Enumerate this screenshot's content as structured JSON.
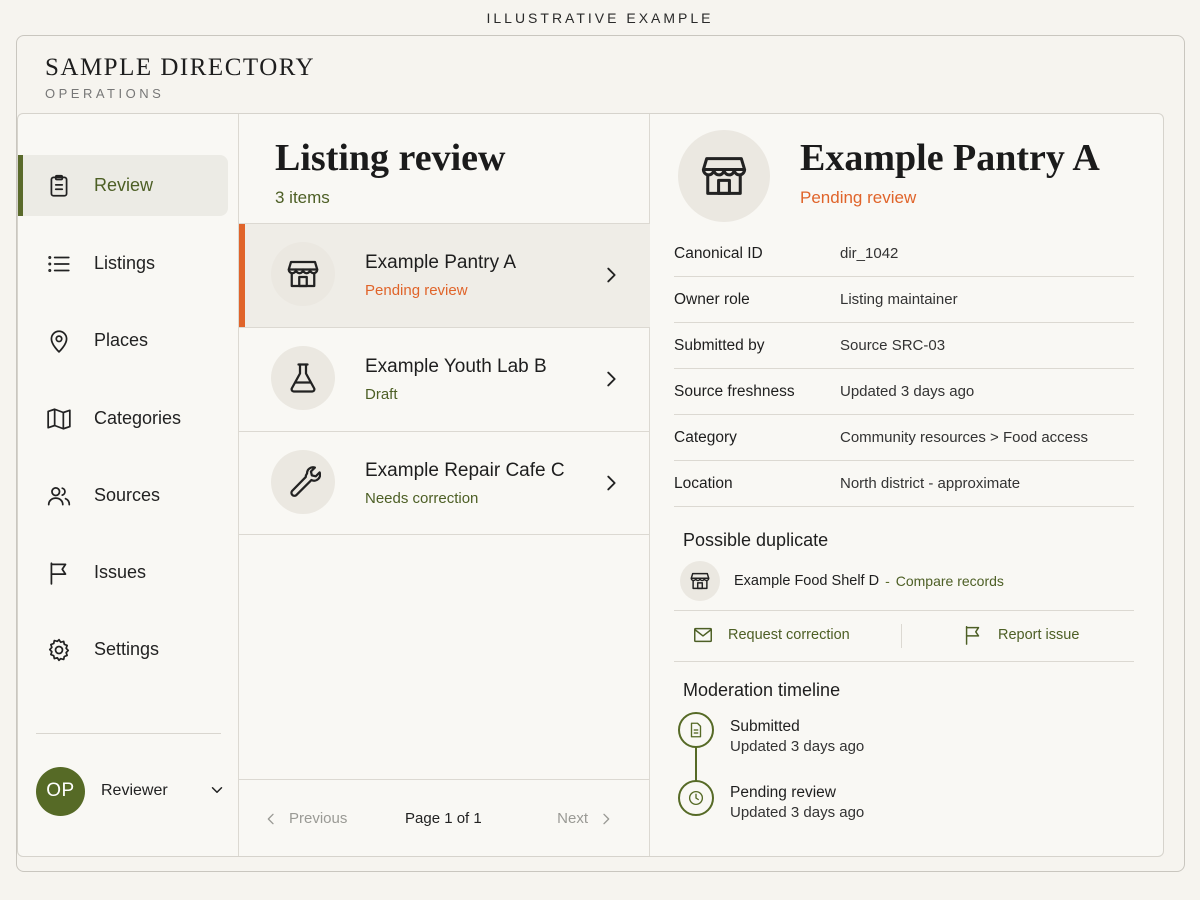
{
  "caption": "ILLUSTRATIVE EXAMPLE",
  "brand": {
    "title": "SAMPLE DIRECTORY",
    "subtitle": "OPERATIONS"
  },
  "sidebar": {
    "items": [
      {
        "label": "Review",
        "icon": "clipboard-icon",
        "active": true
      },
      {
        "label": "Listings",
        "icon": "list-icon"
      },
      {
        "label": "Places",
        "icon": "map-pin-icon"
      },
      {
        "label": "Categories",
        "icon": "map-icon"
      },
      {
        "label": "Sources",
        "icon": "users-icon"
      },
      {
        "label": "Issues",
        "icon": "flag-icon"
      },
      {
        "label": "Settings",
        "icon": "gear-icon"
      }
    ],
    "user": {
      "initials": "OP",
      "name": "Reviewer"
    }
  },
  "list": {
    "title": "Listing review",
    "count": "3 items",
    "items": [
      {
        "title": "Example Pantry A",
        "status": "Pending review",
        "status_color": "#e0642a",
        "icon": "storefront-icon"
      },
      {
        "title": "Example Youth Lab B",
        "status": "Draft",
        "status_color": "#4d5f25",
        "icon": "flask-icon"
      },
      {
        "title": "Example Repair Cafe C",
        "status": "Needs correction",
        "status_color": "#4d5f25",
        "icon": "wrench-icon"
      }
    ],
    "pager": {
      "previous": "Previous",
      "page": "Page 1 of 1",
      "next": "Next"
    }
  },
  "detail": {
    "title": "Example Pantry A",
    "status": "Pending review",
    "fields": [
      {
        "label": "Canonical ID",
        "value": "dir_1042"
      },
      {
        "label": "Owner role",
        "value": "Listing maintainer"
      },
      {
        "label": "Submitted by",
        "value": "Source SRC-03"
      },
      {
        "label": "Source freshness",
        "value": "Updated 3 days ago"
      },
      {
        "label": "Category",
        "value": "Community resources > Food access"
      },
      {
        "label": "Location",
        "value": "North district - approximate"
      }
    ],
    "duplicate": {
      "heading": "Possible duplicate",
      "name": "Example Food Shelf D",
      "separator": "-",
      "link": "Compare records"
    },
    "actions": {
      "request": "Request correction",
      "report": "Report issue"
    },
    "timeline": {
      "heading": "Moderation timeline",
      "events": [
        {
          "title": "Submitted",
          "sub": "Updated 3 days ago",
          "icon": "document-icon"
        },
        {
          "title": "Pending review",
          "sub": "Updated 3 days ago",
          "icon": "clock-icon"
        }
      ]
    }
  },
  "colors": {
    "accent": "#566a26",
    "alert": "#e0642a",
    "background": "#f6f4ef"
  }
}
